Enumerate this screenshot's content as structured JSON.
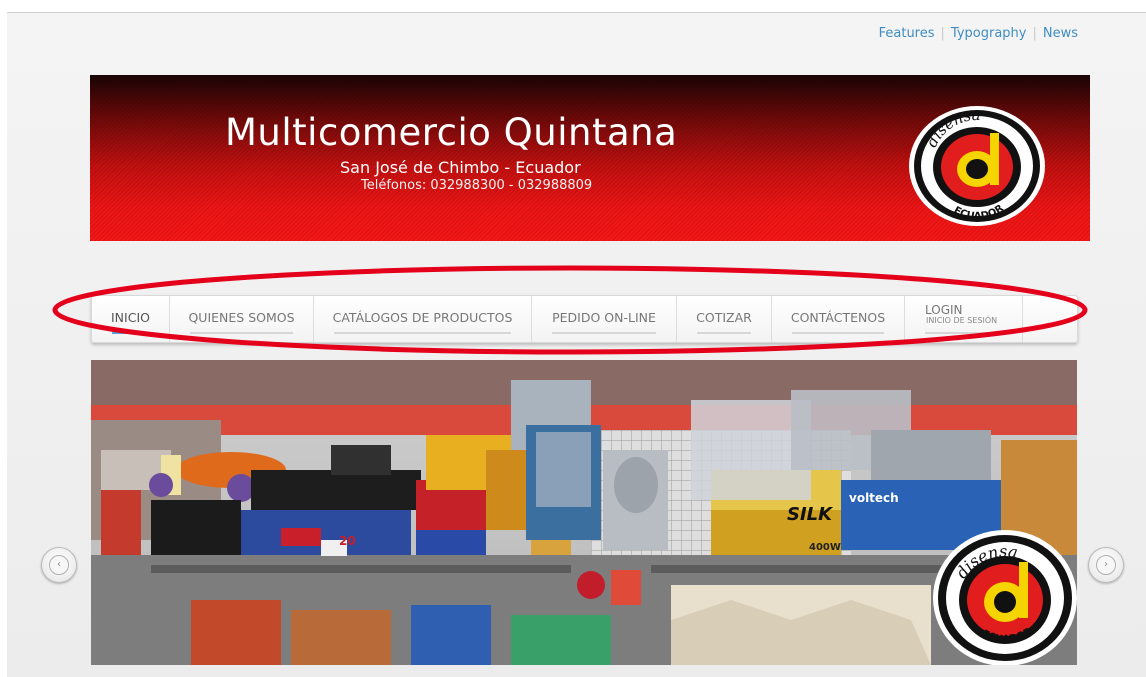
{
  "top_links": [
    "Features",
    "Typography",
    "News"
  ],
  "banner": {
    "title": "Multicomercio Quintana",
    "subtitle": "San José de Chimbo - Ecuador",
    "phones": "Teléfonos: 032988300 - 032988809",
    "logo_text_top": "disensa",
    "logo_text_bottom": "ECUADOR"
  },
  "menu": {
    "items": [
      "INICIO",
      "QUIENES SOMOS",
      "CATÁLOGOS DE PRODUCTOS",
      "PEDIDO ON-LINE",
      "COTIZAR",
      "CONTÁCTENOS"
    ],
    "active_index": 0,
    "login_label": "LOGIN",
    "login_sublabel": "INICIO DE SESIÓN"
  },
  "slider": {
    "logo_text_top": "disensa",
    "logo_text_bottom": "ECUADOR",
    "product_labels": [
      "SILK",
      "voltech",
      "400W",
      "20"
    ]
  },
  "colors": {
    "banner_red": "#e81515",
    "menu_active_underline": "#4ea6d9",
    "link_blue": "#3f8dc3",
    "annotation_red": "#e4001b",
    "logo_yellow": "#f6d400"
  },
  "icons": {
    "prev": "chevron-left-icon",
    "next": "chevron-right-icon"
  }
}
